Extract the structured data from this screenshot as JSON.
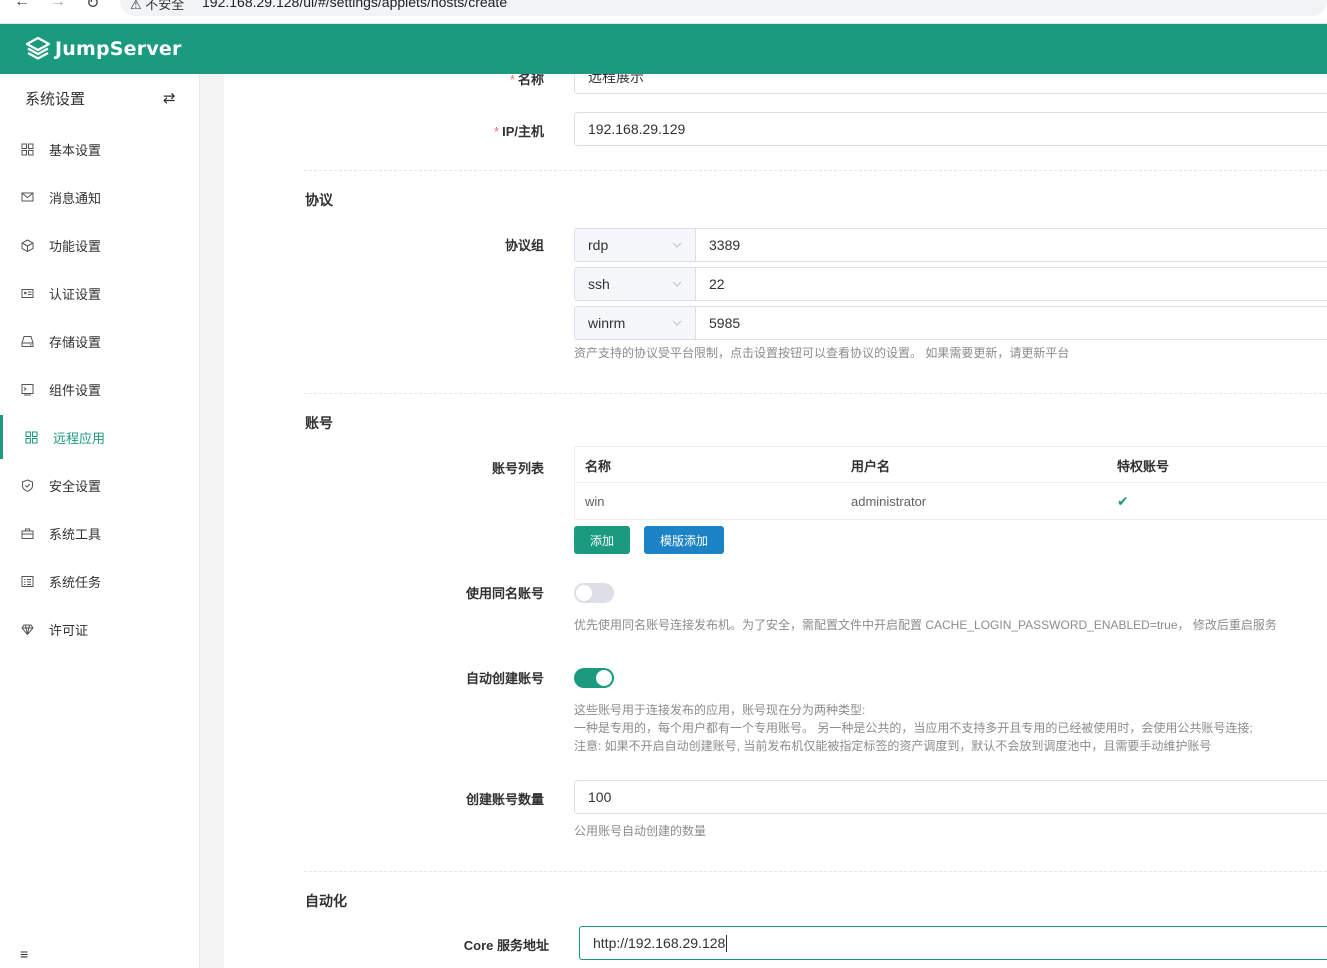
{
  "browser": {
    "back_glyph": "←",
    "forward_glyph": "→",
    "reload_glyph": "↻",
    "security_label": "⚠ 不安全",
    "url": "192.168.29.128/ui/#/settings/applets/hosts/create"
  },
  "header": {
    "logo_text": "JumpServer",
    "brand_color": "#1a9a7e"
  },
  "sidebar": {
    "title": "系统设置",
    "toggle_glyph": "⇄",
    "items": [
      {
        "label": "基本设置",
        "icon": "grid-icon"
      },
      {
        "label": "消息通知",
        "icon": "message-icon"
      },
      {
        "label": "功能设置",
        "icon": "cube-icon"
      },
      {
        "label": "认证设置",
        "icon": "id-card-icon"
      },
      {
        "label": "存储设置",
        "icon": "storage-icon"
      },
      {
        "label": "组件设置",
        "icon": "terminal-icon"
      },
      {
        "label": "远程应用",
        "icon": "apps-icon",
        "active": true
      },
      {
        "label": "安全设置",
        "icon": "shield-icon"
      },
      {
        "label": "系统工具",
        "icon": "toolbox-icon"
      },
      {
        "label": "系统任务",
        "icon": "task-icon"
      },
      {
        "label": "许可证",
        "icon": "diamond-icon"
      }
    ],
    "collapse_glyph": "≡"
  },
  "form": {
    "name_label": "名称",
    "name_value": "远程展示",
    "host_label": "IP/主机",
    "host_value": "192.168.29.129",
    "required_mark": "*",
    "protocol_section": "协议",
    "protocol_group_label": "协议组",
    "protocols": [
      {
        "name": "rdp",
        "port": "3389"
      },
      {
        "name": "ssh",
        "port": "22"
      },
      {
        "name": "winrm",
        "port": "5985"
      }
    ],
    "protocol_hint": "资产支持的协议受平台限制，点击设置按钮可以查看协议的设置。 如果需要更新，请更新平台",
    "account_section": "账号",
    "account_list_label": "账号列表",
    "account_table": {
      "headers": [
        "名称",
        "用户名",
        "特权账号"
      ],
      "rows": [
        {
          "name": "win",
          "username": "administrator",
          "privileged": "✔"
        }
      ]
    },
    "add_button": "添加",
    "template_add_button": "模版添加",
    "same_name_label": "使用同名账号",
    "same_name_enabled": false,
    "same_name_hint": "优先使用同名账号连接发布机。为了安全，需配置文件中开启配置 CACHE_LOGIN_PASSWORD_ENABLED=true， 修改后重启服务",
    "auto_create_label": "自动创建账号",
    "auto_create_enabled": true,
    "auto_create_hint_1": "这些账号用于连接发布的应用，账号现在分为两种类型:",
    "auto_create_hint_2": "一种是专用的，每个用户都有一个专用账号。 另一种是公共的，当应用不支持多开且专用的已经被使用时，会使用公共账号连接;",
    "auto_create_hint_3": "注意: 如果不开启自动创建账号, 当前发布机仅能被指定标签的资产调度到，默认不会放到调度池中，且需要手动维护账号",
    "account_count_label": "创建账号数量",
    "account_count_value": "100",
    "account_count_hint": "公用账号自动创建的数量",
    "automation_section": "自动化",
    "core_label": "Core 服务地址",
    "core_value": "http://192.168.29.128"
  },
  "colors": {
    "primary": "#1a9a7e",
    "info": "#1c84c6"
  }
}
